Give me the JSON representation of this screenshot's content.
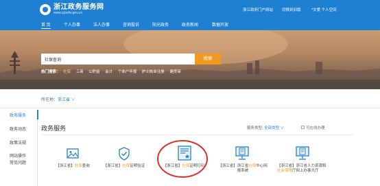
{
  "header": {
    "logo_title": "浙江政务服务网",
    "logo_sub": "www.zjzwfw.gov.cn",
    "util_links": [
      "浙江政府门户网站",
      "切换到旧版",
      "*文爱 个人空间"
    ]
  },
  "nav": {
    "items": [
      "首 页",
      "个人办事",
      "法人办事",
      "咨询投诉",
      "阳光政务",
      "政务新闻",
      "数据开放"
    ]
  },
  "search": {
    "value": "社保查询",
    "button": "搜索",
    "hot_label": "热门搜索：",
    "hot_items": [
      "社保",
      "工商",
      "公积金",
      "会计",
      "个体户年报",
      "护士执业注册",
      "建房审"
    ]
  },
  "location": {
    "prefix": "所在地：",
    "city": "浙江省",
    "arrow": "∨"
  },
  "sidebar": {
    "items": [
      "政务服务",
      "政务动态",
      "政策法规",
      "网站操作",
      "常见问题"
    ]
  },
  "section": {
    "title": "政务服务",
    "filter_label": "服务类型: ",
    "filter_value": "全部类型",
    "filter_arrow": "∨",
    "checkbox_label": "可在线办理"
  },
  "tiles": [
    {
      "icon": "image-icon",
      "pre": "【浙江省】",
      "kw": "社保",
      "post": "查询"
    },
    {
      "icon": "shield-check-icon",
      "pre": "【浙江省】",
      "kw": "社保",
      "post": "证明验证"
    },
    {
      "icon": "certificate-star-icon",
      "pre": "【浙江省】",
      "kw": "社保",
      "post": "证明打印"
    },
    {
      "icon": "monitor-document-icon",
      "pre": "【浙江省】浙江省",
      "kw": "社保",
      "post": "中心网",
      "line2": "报系统"
    },
    {
      "icon": "monitor-document-icon",
      "pre": "【浙江省】浙江省人力资源和",
      "line2_kw": "社会保障",
      "line2_post": "厅网上办事大厅"
    }
  ],
  "colors": {
    "header_blue": "#1f7fd1",
    "accent_orange": "#f39a1e",
    "highlight_red": "#d9302c"
  }
}
